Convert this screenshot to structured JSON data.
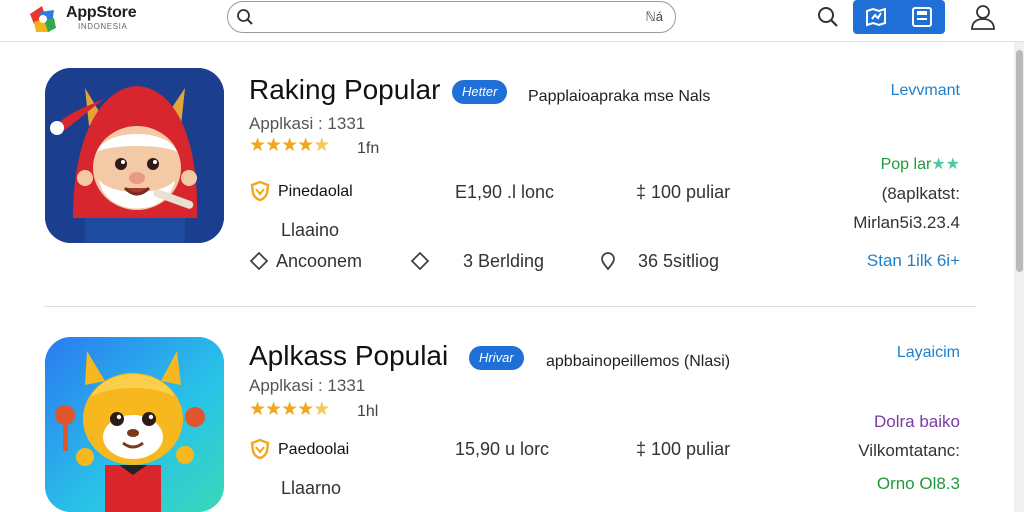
{
  "header": {
    "logo_title": "AppStore",
    "logo_subtitle": "INDONESIA",
    "search_placeholder": "",
    "search_lang": "ℕá"
  },
  "apps": [
    {
      "title": "Raking Popular",
      "badge": "Hetter",
      "tagline": "Papplaioapraka mse Nals",
      "subtitle": "Applkasi :  1331",
      "rating": 4.5,
      "rating_count": "1fn",
      "brand": "Pinedaolal",
      "size": "E1,90 .l lonc",
      "price": "‡ 100 puliar",
      "developer": "Llaaino",
      "meta": [
        {
          "icon": "diamond-outline-icon",
          "label": "Ancoonem"
        },
        {
          "icon": "diamond-outline-icon",
          "label": "3 Berlding"
        },
        {
          "icon": "location-pin-icon",
          "label": "36 5sitliog"
        }
      ],
      "side": {
        "link": "Levvmant",
        "popular": "Pop lar",
        "text1": "(8aplkatst:",
        "text2": "Mirlan5i3.23.4",
        "plus": "Stan 1ilk 6i+"
      }
    },
    {
      "title": "Aplkass Populai",
      "badge": "Hrivar",
      "tagline": "apbbainopeillemos (Nlasi)",
      "subtitle": "Applkasi :  1331",
      "rating": 4.5,
      "rating_count": "1hl",
      "brand": "Paedoolai",
      "size": "15,90 u lorc",
      "price": "‡ 100 puliar",
      "developer": "Llaarno",
      "side": {
        "link": "Layaicim",
        "purple": "Dolra baiko",
        "text3": "Vilkomtatanc:",
        "green": "Orno Ol8.3"
      }
    }
  ],
  "colors": {
    "accent_blue": "#1f6fd6",
    "star": "#f2a61c",
    "link": "#1f7fc9",
    "green": "#1e9a3a",
    "purple": "#7b3aa6"
  }
}
